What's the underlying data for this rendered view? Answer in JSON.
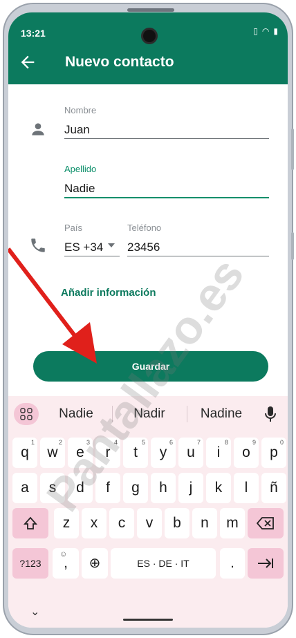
{
  "status_bar": {
    "time": "13:21"
  },
  "app_bar": {
    "title": "Nuevo contacto"
  },
  "form": {
    "first_name": {
      "label": "Nombre",
      "value": "Juan"
    },
    "last_name": {
      "label": "Apellido",
      "value": "Nadie"
    },
    "country": {
      "label": "País",
      "value": "ES +34"
    },
    "phone": {
      "label": "Teléfono",
      "value": "23456"
    },
    "add_info_label": "Añadir información",
    "save_label": "Guardar"
  },
  "keyboard": {
    "suggestions": [
      "Nadie",
      "Nadir",
      "Nadine"
    ],
    "row1": [
      {
        "k": "q",
        "h": "1"
      },
      {
        "k": "w",
        "h": "2"
      },
      {
        "k": "e",
        "h": "3"
      },
      {
        "k": "r",
        "h": "4"
      },
      {
        "k": "t",
        "h": "5"
      },
      {
        "k": "y",
        "h": "6"
      },
      {
        "k": "u",
        "h": "7"
      },
      {
        "k": "i",
        "h": "8"
      },
      {
        "k": "o",
        "h": "9"
      },
      {
        "k": "p",
        "h": "0"
      }
    ],
    "row2": [
      "a",
      "s",
      "d",
      "f",
      "g",
      "h",
      "j",
      "k",
      "l",
      "ñ"
    ],
    "row3": [
      "z",
      "x",
      "c",
      "v",
      "b",
      "n",
      "m"
    ],
    "symbols_label": "?123",
    "comma_label": ",",
    "space_label": "ES · DE · IT",
    "period_label": "."
  },
  "watermark": "Pantallazo.es",
  "colors": {
    "app_bar": "#0c7a5e",
    "accent": "#0c8f6a",
    "keyboard_bg": "#fbecef",
    "function_key": "#f4c6d6",
    "arrow": "#e0201b"
  }
}
